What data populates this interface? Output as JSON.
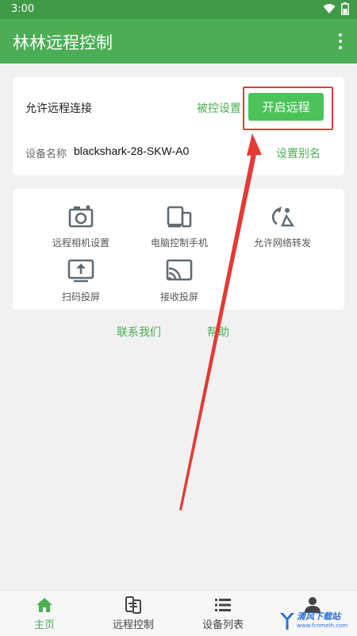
{
  "status_bar": {
    "time": "3:00"
  },
  "app_bar": {
    "title": "林林远程控制"
  },
  "remote_card": {
    "allow_label": "允许远程连接",
    "controlled_settings": "被控设置",
    "start_remote_button": "开启远程",
    "device_name_label": "设备名称",
    "device_name": "blackshark-28-SKW-A0",
    "set_alias": "设置别名"
  },
  "features": [
    {
      "label": "远程相机设置",
      "icon": "camera-icon"
    },
    {
      "label": "电脑控制手机",
      "icon": "pc-phone-icon"
    },
    {
      "label": "允许网络转发",
      "icon": "network-forward-icon"
    },
    {
      "label": "扫码投屏",
      "icon": "upload-screen-icon"
    },
    {
      "label": "接收投屏",
      "icon": "cast-icon"
    }
  ],
  "links": {
    "contact": "联系我们",
    "help": "帮助"
  },
  "bottom_nav": [
    {
      "label": "主页",
      "icon": "home-icon",
      "active": true
    },
    {
      "label": "远程控制",
      "icon": "remote-control-icon",
      "active": false
    },
    {
      "label": "设备列表",
      "icon": "list-icon",
      "active": false
    },
    {
      "label": "",
      "icon": "person-icon",
      "active": false
    }
  ],
  "watermark": {
    "text": "清风下载站",
    "url": "www.fcnmeih.com"
  },
  "colors": {
    "primary": "#4cae54",
    "status_bar": "#3f9a48",
    "button": "#4cc35a",
    "annotation": "#e53935"
  }
}
